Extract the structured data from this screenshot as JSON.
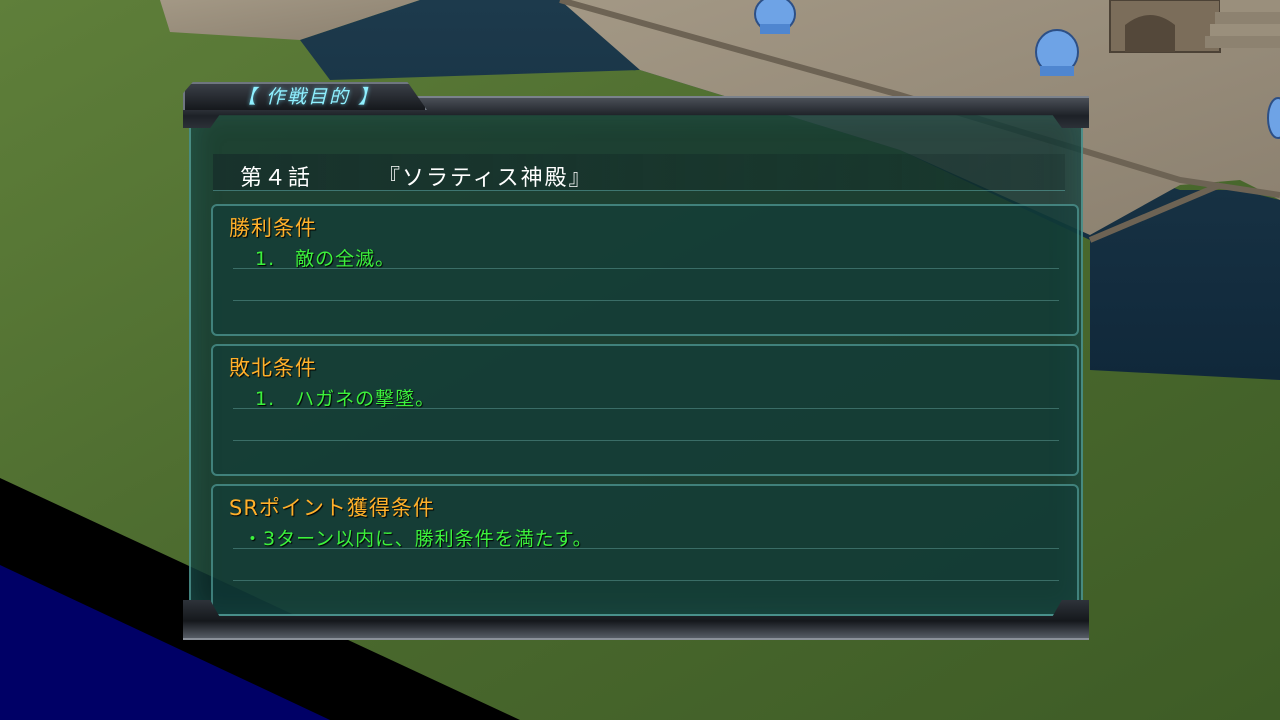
{
  "window": {
    "tab_label": "【 作戦目的 】",
    "episode": "第４話",
    "stage_name": "『ソラティス神殿』"
  },
  "sections": [
    {
      "title": "勝利条件",
      "item": "1.　敵の全滅。"
    },
    {
      "title": "敗北条件",
      "item": "1.　ハガネの撃墜。"
    },
    {
      "title": "SRポイント獲得条件",
      "item": "・3ターン以内に、勝利条件を満たす。"
    }
  ],
  "colors": {
    "tab_text": "#8ff0ff",
    "section_title": "#ffb02a",
    "condition_text": "#3cf23c",
    "panel": "#10343a"
  }
}
